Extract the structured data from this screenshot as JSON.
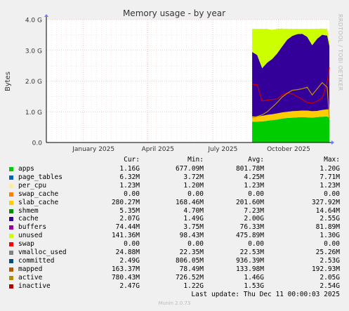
{
  "chart_data": {
    "type": "area",
    "title": "Memory usage - by year",
    "ylabel": "Bytes",
    "ylim": [
      0,
      4.0
    ],
    "yunit": "G",
    "yticks": [
      "0.0",
      "1.0 G",
      "2.0 G",
      "3.0 G",
      "4.0 G"
    ],
    "xticks": [
      "January 2025",
      "April 2025",
      "July 2025",
      "October 2025"
    ],
    "x_dates": [
      "2025-08-25",
      "2025-09-01",
      "2025-09-08",
      "2025-09-15",
      "2025-09-22",
      "2025-09-29",
      "2025-10-06",
      "2025-10-13",
      "2025-10-20",
      "2025-10-27",
      "2025-11-03",
      "2025-11-10",
      "2025-11-17",
      "2025-11-24",
      "2025-12-01",
      "2025-12-08",
      "2025-12-11"
    ],
    "series": [
      {
        "name": "apps",
        "color": "#00cc00",
        "values": [
          0.68,
          0.68,
          0.69,
          0.71,
          0.73,
          0.75,
          0.78,
          0.8,
          0.81,
          0.82,
          0.83,
          0.82,
          0.81,
          0.83,
          0.84,
          0.85,
          0.8
        ]
      },
      {
        "name": "slab_cache",
        "color": "#ffcc00",
        "values": [
          0.17,
          0.17,
          0.18,
          0.19,
          0.19,
          0.2,
          0.2,
          0.2,
          0.21,
          0.21,
          0.21,
          0.22,
          0.21,
          0.2,
          0.22,
          0.23,
          0.28
        ]
      },
      {
        "name": "cache",
        "color": "#330099",
        "values": [
          2.1,
          2.0,
          1.55,
          1.7,
          1.8,
          1.95,
          2.15,
          2.35,
          2.45,
          2.5,
          2.5,
          2.4,
          2.15,
          2.35,
          2.45,
          2.4,
          2.07
        ]
      },
      {
        "name": "unused",
        "color": "#ccff00",
        "values": [
          0.75,
          0.85,
          1.28,
          1.1,
          0.95,
          0.8,
          0.58,
          0.35,
          0.23,
          0.17,
          0.16,
          0.26,
          0.53,
          0.32,
          0.2,
          0.22,
          0.14
        ]
      }
    ],
    "lines": [
      {
        "name": "committed",
        "color": "#cc0000",
        "values": [
          1.9,
          1.88,
          1.35,
          1.38,
          1.4,
          1.42,
          1.55,
          1.62,
          1.58,
          1.5,
          1.4,
          1.3,
          1.28,
          1.35,
          1.45,
          1.95,
          2.45
        ]
      },
      {
        "name": "active",
        "color": "#c09000",
        "values": [
          0.8,
          0.85,
          0.9,
          1.0,
          1.15,
          1.3,
          1.48,
          1.6,
          1.7,
          1.72,
          1.75,
          1.8,
          1.55,
          1.75,
          1.95,
          1.8,
          0.78
        ]
      }
    ]
  },
  "legend": {
    "headers": [
      "Cur:",
      "Min:",
      "Avg:",
      "Max:"
    ],
    "rows": [
      {
        "name": "apps",
        "color": "#00cc00",
        "cur": "1.16G",
        "min": "677.09M",
        "avg": "801.78M",
        "max": "1.20G"
      },
      {
        "name": "page_tables",
        "color": "#0066b3",
        "cur": "6.32M",
        "min": "3.72M",
        "avg": "4.25M",
        "max": "7.71M"
      },
      {
        "name": "per_cpu",
        "color": "#ffee99",
        "cur": "1.23M",
        "min": "1.20M",
        "avg": "1.23M",
        "max": "1.23M"
      },
      {
        "name": "swap_cache",
        "color": "#ff8000",
        "cur": "0.00",
        "min": "0.00",
        "avg": "0.00",
        "max": "0.00"
      },
      {
        "name": "slab_cache",
        "color": "#ffcc00",
        "cur": "280.27M",
        "min": "168.46M",
        "avg": "201.60M",
        "max": "327.92M"
      },
      {
        "name": "shmem",
        "color": "#008f00",
        "cur": "5.35M",
        "min": "4.70M",
        "avg": "7.23M",
        "max": "14.64M"
      },
      {
        "name": "cache",
        "color": "#330099",
        "cur": "2.07G",
        "min": "1.49G",
        "avg": "2.00G",
        "max": "2.55G"
      },
      {
        "name": "buffers",
        "color": "#990099",
        "cur": "74.44M",
        "min": "3.75M",
        "avg": "76.33M",
        "max": "81.89M"
      },
      {
        "name": "unused",
        "color": "#ccff00",
        "cur": "141.36M",
        "min": "98.43M",
        "avg": "475.89M",
        "max": "1.30G"
      },
      {
        "name": "swap",
        "color": "#ff0000",
        "cur": "0.00",
        "min": "0.00",
        "avg": "0.00",
        "max": "0.00"
      },
      {
        "name": "vmalloc_used",
        "color": "#808080",
        "cur": "24.88M",
        "min": "22.35M",
        "avg": "22.53M",
        "max": "25.26M"
      },
      {
        "name": "committed",
        "color": "#004d80",
        "cur": "2.49G",
        "min": "806.05M",
        "avg": "936.39M",
        "max": "2.53G"
      },
      {
        "name": "mapped",
        "color": "#b35a00",
        "cur": "163.37M",
        "min": "78.49M",
        "avg": "133.98M",
        "max": "192.93M"
      },
      {
        "name": "active",
        "color": "#b38f00",
        "cur": "780.43M",
        "min": "726.52M",
        "avg": "1.46G",
        "max": "2.05G"
      },
      {
        "name": "inactive",
        "color": "#b30000",
        "cur": "2.47G",
        "min": "1.22G",
        "avg": "1.53G",
        "max": "2.54G"
      }
    ]
  },
  "last_update": "Last update: Thu Dec 11 00:00:03 2025",
  "footer": "Munin 2.0.73",
  "side_text": "RRDTOOL / TOBI OETIKER"
}
